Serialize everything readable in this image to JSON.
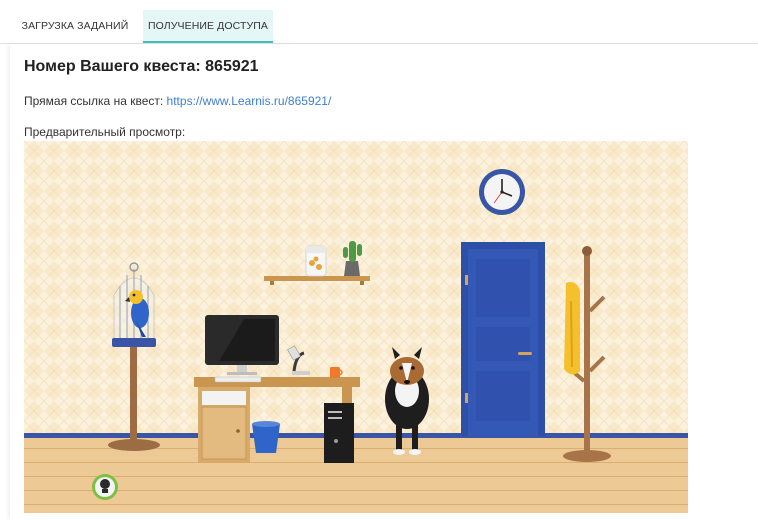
{
  "tabs": [
    {
      "label": "ЗАГРУЗКА ЗАДАНИЙ",
      "active": false
    },
    {
      "label": "ПОЛУЧЕНИЕ ДОСТУПА",
      "active": true
    }
  ],
  "quest": {
    "title": "Номер Вашего квеста: 865921",
    "link_label": "Прямая ссылка на квест:",
    "link_url": "https://www.Learnis.ru/865921/",
    "preview_label": "Предварительный просмотр:"
  },
  "scene": {
    "items": [
      "wall-clock-icon",
      "door-icon",
      "coat-rack-icon",
      "scarf-icon",
      "bird-cage-icon",
      "parrot-icon",
      "shelf-icon",
      "cactus-icon",
      "cookie-jar-icon",
      "monitor-icon",
      "keyboard-icon",
      "microscope-icon",
      "mug-icon",
      "desk-icon",
      "trash-bin-icon",
      "computer-tower-icon",
      "dog-icon",
      "hint-bulb-icon"
    ],
    "cookie_jar_label": "Печенье",
    "colors": {
      "wall": "#fbefd6",
      "floor": "#edc68f",
      "baseboard": "#3a55a6",
      "door": "#2a4fa8"
    }
  }
}
